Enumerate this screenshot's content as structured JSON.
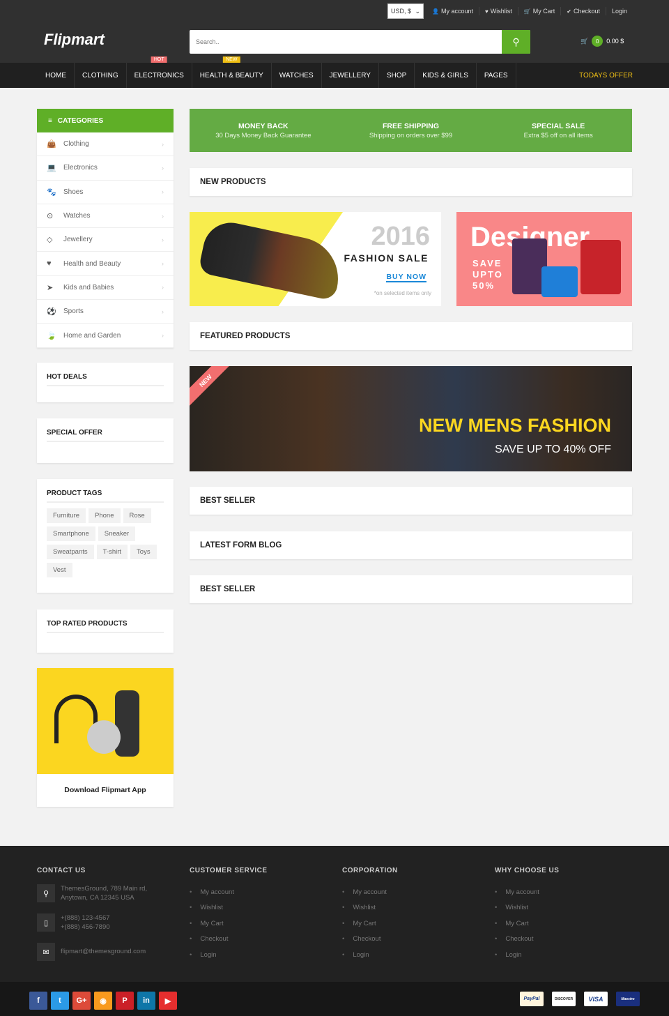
{
  "topbar": {
    "currency": "USD, $",
    "links": [
      {
        "icon": "user-icon",
        "label": "My account"
      },
      {
        "icon": "heart-icon",
        "label": "Wishlist"
      },
      {
        "icon": "cart-icon",
        "label": "My Cart"
      },
      {
        "icon": "check-icon",
        "label": "Checkout"
      },
      {
        "icon": "",
        "label": "Login"
      }
    ]
  },
  "header": {
    "logo": "Flipmart",
    "search_placeholder": "Search..",
    "cart_count": "0",
    "cart_total": "0.00 $"
  },
  "nav": {
    "items": [
      {
        "label": "HOME"
      },
      {
        "label": "CLOTHING"
      },
      {
        "label": "ELECTRONICS",
        "badge": "HOT"
      },
      {
        "label": "HEALTH & BEAUTY",
        "badge": "NEW"
      },
      {
        "label": "WATCHES"
      },
      {
        "label": "JEWELLERY"
      },
      {
        "label": "SHOP"
      },
      {
        "label": "KIDS & GIRLS"
      },
      {
        "label": "PAGES"
      }
    ],
    "todays_offer": "TODAYS OFFER"
  },
  "sidebar": {
    "categories_title": "CATEGORIES",
    "categories": [
      {
        "label": "Clothing",
        "icon": "shopping-bag-icon"
      },
      {
        "label": "Electronics",
        "icon": "laptop-icon"
      },
      {
        "label": "Shoes",
        "icon": "paw-icon"
      },
      {
        "label": "Watches",
        "icon": "clock-icon"
      },
      {
        "label": "Jewellery",
        "icon": "diamond-icon"
      },
      {
        "label": "Health and Beauty",
        "icon": "heartbeat-icon"
      },
      {
        "label": "Kids and Babies",
        "icon": "paper-plane-icon"
      },
      {
        "label": "Sports",
        "icon": "football-icon"
      },
      {
        "label": "Home and Garden",
        "icon": "leaf-icon"
      }
    ],
    "hot_deals": "HOT DEALS",
    "special_offer": "SPECIAL OFFER",
    "product_tags_title": "PRODUCT TAGS",
    "tags": [
      "Furniture",
      "Phone",
      "Rose",
      "Smartphone",
      "Sneaker",
      "Sweatpants",
      "T-shirt",
      "Toys",
      "Vest"
    ],
    "top_rated": "TOP RATED PRODUCTS",
    "app_label": "Download Flipmart App"
  },
  "info": [
    {
      "title": "MONEY BACK",
      "sub": "30 Days Money Back Guarantee"
    },
    {
      "title": "FREE SHIPPING",
      "sub": "Shipping on orders over $99"
    },
    {
      "title": "SPECIAL SALE",
      "sub": "Extra $5 off on all items"
    }
  ],
  "sections": {
    "new_products": "NEW PRODUCTS",
    "featured": "FEATURED PRODUCTS",
    "best_seller": "BEST SELLER",
    "blog": "LATEST FORM BLOG",
    "best_seller2": "BEST SELLER"
  },
  "banners": {
    "b1_year": "2016",
    "b1_title": "FASHION SALE",
    "b1_cta": "BUY NOW",
    "b1_note": "*on selected items only",
    "b2_title": "Designer",
    "b2_save": "SAVE",
    "b2_upto": "UPTO",
    "b2_pct": "50%",
    "b3_badge": "NEW",
    "b3_title": "NEW MENS FASHION",
    "b3_sub": "SAVE UP TO 40% OFF"
  },
  "footer": {
    "contact_title": "CONTACT US",
    "address": [
      "ThemesGround, 789 Main rd,",
      "Anytown, CA 12345 USA"
    ],
    "phones": [
      "+(888) 123-4567",
      "+(888) 456-7890"
    ],
    "email": "flipmart@themesground.com",
    "columns": [
      {
        "title": "CUSTOMER SERVICE",
        "links": [
          "My account",
          "Wishlist",
          "My Cart",
          "Checkout",
          "Login"
        ]
      },
      {
        "title": "CORPORATION",
        "links": [
          "My account",
          "Wishlist",
          "My Cart",
          "Checkout",
          "Login"
        ]
      },
      {
        "title": "WHY CHOOSE US",
        "links": [
          "My account",
          "Wishlist",
          "My Cart",
          "Checkout",
          "Login"
        ]
      }
    ]
  },
  "social": [
    {
      "name": "facebook",
      "glyph": "f",
      "color": "#3b5998"
    },
    {
      "name": "twitter",
      "glyph": "t",
      "color": "#2b9ae6"
    },
    {
      "name": "google-plus",
      "glyph": "G+",
      "color": "#dd4b39"
    },
    {
      "name": "rss",
      "glyph": "◉",
      "color": "#f89a1e"
    },
    {
      "name": "pinterest",
      "glyph": "P",
      "color": "#cb2027"
    },
    {
      "name": "linkedin",
      "glyph": "in",
      "color": "#0e76a8"
    },
    {
      "name": "youtube",
      "glyph": "▶",
      "color": "#e62e2e"
    }
  ],
  "payments": [
    "PayPal",
    "DISCOVER",
    "VISA",
    "Maestro"
  ]
}
